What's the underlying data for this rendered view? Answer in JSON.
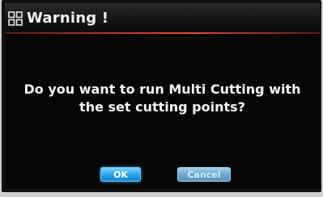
{
  "dialog": {
    "title": "Warning !",
    "title_icon": "grid-icon",
    "message_line1": "Do you want to run Multi Cutting with",
    "message_line2": "the set cutting points?"
  },
  "buttons": {
    "ok_label": "OK",
    "cancel_label": "Cancel"
  },
  "colors": {
    "background": "#060606",
    "title_accent": "#c83c2a",
    "ok_button": "#2aa6ee",
    "cancel_button": "#6fa9cf",
    "text": "#f4f4f4"
  }
}
